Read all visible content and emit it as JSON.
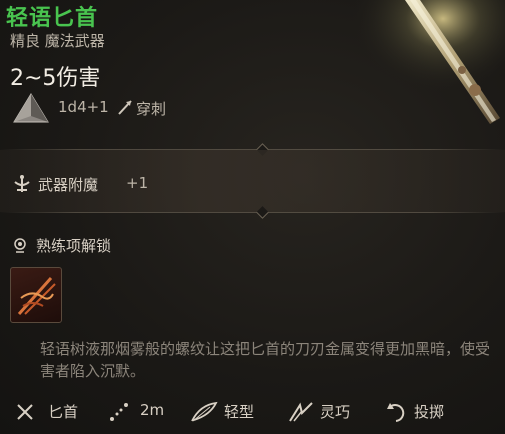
{
  "item": {
    "name": "轻语匕首",
    "type": "精良 魔法武器",
    "damage_total": "2~5伤害",
    "damage_dice": "1d4+1",
    "damage_type": "穿刺",
    "damage_die_icon": "d4-die-icon",
    "damage_type_icon": "pierce-icon"
  },
  "enchant": {
    "label": "武器附魔",
    "value": "+1",
    "icon": "enchant-icon"
  },
  "proficiency": {
    "label": "熟练项解锁",
    "icon": "proficiency-icon",
    "action_icon": "rend-action-icon"
  },
  "description": "轻语树液那烟雾般的螺纹让这把匕首的刀刃金属变得更加黑暗，使受害者陷入沉默。",
  "properties": [
    {
      "icon": "dagger-icon",
      "label": "匕首"
    },
    {
      "icon": "range-icon",
      "label": "2m"
    },
    {
      "icon": "feather-icon",
      "label": "轻型"
    },
    {
      "icon": "finesse-icon",
      "label": "灵巧"
    },
    {
      "icon": "thrown-icon",
      "label": "投掷"
    }
  ],
  "colors": {
    "name_green": "#49c44f",
    "background": "#1b1916",
    "text_muted": "#8c857b"
  }
}
